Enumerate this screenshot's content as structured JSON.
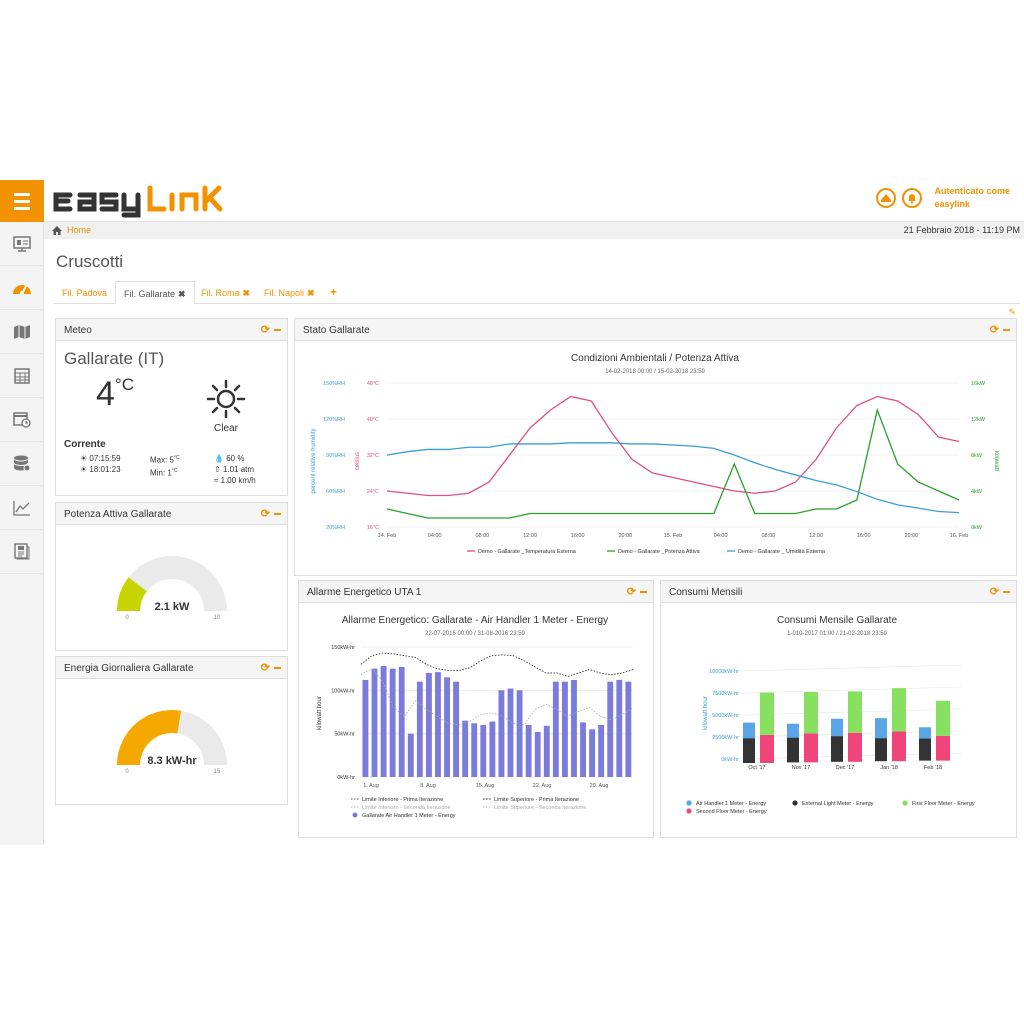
{
  "header": {
    "logo": "easylink",
    "user_line1": "Autenticato come",
    "user_line2": "easylink",
    "menu_icon": "hamburger-icon",
    "accent": "#f39200"
  },
  "sidebar": {
    "items": [
      {
        "icon": "presentation-icon"
      },
      {
        "icon": "dashboard-gauge-icon"
      },
      {
        "icon": "map-icon"
      },
      {
        "icon": "table-icon"
      },
      {
        "icon": "calendar-clock-icon"
      },
      {
        "icon": "database-icon"
      },
      {
        "icon": "line-chart-icon"
      },
      {
        "icon": "report-icon"
      }
    ]
  },
  "breadcrumb": {
    "home": "Home",
    "datetime": "21 Febbraio 2018 - 11:19 PM"
  },
  "page": {
    "title": "Cruscotti"
  },
  "tabs": [
    {
      "label": "Fil. Padova",
      "closable": false,
      "active": false
    },
    {
      "label": "Fil. Gallarate",
      "closable": true,
      "active": true
    },
    {
      "label": "Fil. Roma",
      "closable": true,
      "active": false
    },
    {
      "label": "Fil. Napoli",
      "closable": true,
      "active": false
    }
  ],
  "meteo": {
    "title": "Meteo",
    "city": "Gallarate (IT)",
    "temp": "4",
    "unit": "°C",
    "condition": "Clear",
    "corrente": "Corrente",
    "sunrise": "07:15:59",
    "sunset": "18:01:23",
    "max": "Max: 5",
    "min": "Min: 1",
    "deg": "°C",
    "humidity": "60 %",
    "pressure": "1.01 atm",
    "wind": "1.00 km/h"
  },
  "potenza": {
    "title": "Potenza Attiva Gallarate",
    "value": "2.1 kW",
    "min": "0",
    "max": "10",
    "level": 0.21,
    "color": "#c8d400"
  },
  "energia": {
    "title": "Energia Giornaliera Gallarate",
    "value": "8.3 kW-hr",
    "min": "0",
    "max": "15",
    "level": 0.553,
    "color": "#f5a800"
  },
  "stato": {
    "title": "Stato Gallarate"
  },
  "allarme": {
    "title": "Allarme Energetico UTA 1"
  },
  "consumi": {
    "title": "Consumi Mensili"
  },
  "chart_data": [
    {
      "type": "line",
      "title": "Condizioni Ambientali / Potenza Attiva",
      "subtitle": "14-02-2018 00:00 / 15-02-2018 23:59",
      "x_ticks": [
        "14. Feb",
        "04:00",
        "08:00",
        "12:00",
        "16:00",
        "20:00",
        "15. Feb",
        "04:00",
        "08:00",
        "12:00",
        "16:00",
        "20:00",
        "16. Feb"
      ],
      "y_left_humidity": {
        "label": "percent relative humidity",
        "ticks": [
          "20%RH",
          "60%RH",
          "90%RH",
          "120%RH",
          "150%RH"
        ],
        "color": "#3a9ed4"
      },
      "y_left_temp": {
        "label": "celsius",
        "ticks": [
          "16°C",
          "24°C",
          "32°C",
          "40°C",
          "48°C"
        ],
        "color": "#e0507a"
      },
      "y_right_power": {
        "label": "kilowatt",
        "ticks": [
          "0kW",
          "4kW",
          "8kW",
          "12kW",
          "16kW"
        ],
        "color": "#2aa02a"
      },
      "series": [
        {
          "name": "Demo - Gallarate _Temperatura Esterna",
          "color": "#e0507a",
          "unit": "°C",
          "values": [
            24,
            23.5,
            23,
            23,
            23.5,
            26,
            32,
            38,
            42,
            45,
            44,
            37,
            31,
            28,
            27,
            26,
            25,
            24,
            23.5,
            24,
            26,
            31,
            38,
            43,
            45,
            44,
            41,
            36,
            35
          ]
        },
        {
          "name": "Demo - Gallarate _Potenza Attiva",
          "color": "#2aa02a",
          "unit": "kW",
          "values": [
            2,
            1.5,
            1,
            1,
            1,
            1,
            1,
            1.5,
            1.5,
            1.5,
            1.5,
            1.5,
            1.5,
            1.5,
            1.5,
            1.5,
            1.5,
            7,
            1.5,
            1.5,
            1.5,
            2,
            2,
            3,
            13,
            7,
            5,
            4,
            3
          ]
        },
        {
          "name": "Demo - Gallarate _ Umidità Esterna",
          "color": "#3a9ed4",
          "unit": "%RH",
          "values": [
            85,
            88,
            90,
            90,
            92,
            92,
            95,
            95,
            95,
            96,
            96,
            96,
            95,
            95,
            94,
            93,
            91,
            85,
            78,
            72,
            67,
            62,
            58,
            52,
            45,
            40,
            37,
            34,
            33
          ]
        }
      ]
    },
    {
      "type": "bar",
      "title": "Allarme Energetico: Gallarate - Air Handler 1 Meter - Energy",
      "subtitle": "22-07-2016 00:00 / 31-08-2016 23:59",
      "y_label": "kilowatt hour",
      "y_ticks": [
        "0kW-hr",
        "50kW-hr",
        "100kW-hr",
        "150kW-hr"
      ],
      "x_ticks": [
        "1. Aug",
        "8. Aug",
        "15. Aug",
        "22. Aug",
        "29. Aug"
      ],
      "series": [
        {
          "name": "Gallarate Air Handler 1 Meter - Energy",
          "color": "#7b7bdb",
          "values": [
            112,
            125,
            128,
            125,
            127,
            50,
            110,
            120,
            121,
            115,
            110,
            65,
            62,
            60,
            64,
            100,
            102,
            100,
            60,
            52,
            59,
            110,
            110,
            112,
            63,
            55,
            60,
            110,
            112,
            110
          ]
        }
      ],
      "lines": [
        {
          "name": "Limite Inferiore - Prima Iterazione",
          "style": "dotted"
        },
        {
          "name": "Limite Superiore - Prima Iterazione",
          "style": "dotted-dark"
        },
        {
          "name": "Limite Inferiore - Seconda Iterazione",
          "style": "dotted-light"
        },
        {
          "name": "Limite Superiore - Seconda Iterazione",
          "style": "dotted-light"
        }
      ]
    },
    {
      "type": "bar",
      "stacked": true,
      "title": "Consumi Mensile Gallarate",
      "subtitle": "1-010-2017 01:00 / 21-02-2018 23:59",
      "y_label": "kilowatt hour",
      "y_ticks": [
        "0kW-hr",
        "2500kW-hr",
        "5000kW-hr",
        "7500kW-hr",
        "10000kW-hr"
      ],
      "categories": [
        "Oct '17",
        "Nov '17",
        "Dec '17",
        "Jan '18",
        "Feb '18"
      ],
      "series": [
        {
          "name": "Air Handler 1 Meter - Energy",
          "color": "#5aa5e6",
          "values": [
            3000,
            2800,
            3300,
            3300,
            2200
          ]
        },
        {
          "name": "External Light Meter - Energy",
          "color": "#333333",
          "values": [
            2800,
            2800,
            2900,
            2600,
            2500
          ]
        },
        {
          "name": "Second Floor Meter - Energy",
          "color": "#f0457a",
          "values": [
            3200,
            3300,
            3300,
            3400,
            2800
          ]
        },
        {
          "name": "First Floor Meter - Energy",
          "color": "#88e060",
          "values": [
            4800,
            4700,
            4700,
            4900,
            4000
          ]
        }
      ]
    }
  ]
}
